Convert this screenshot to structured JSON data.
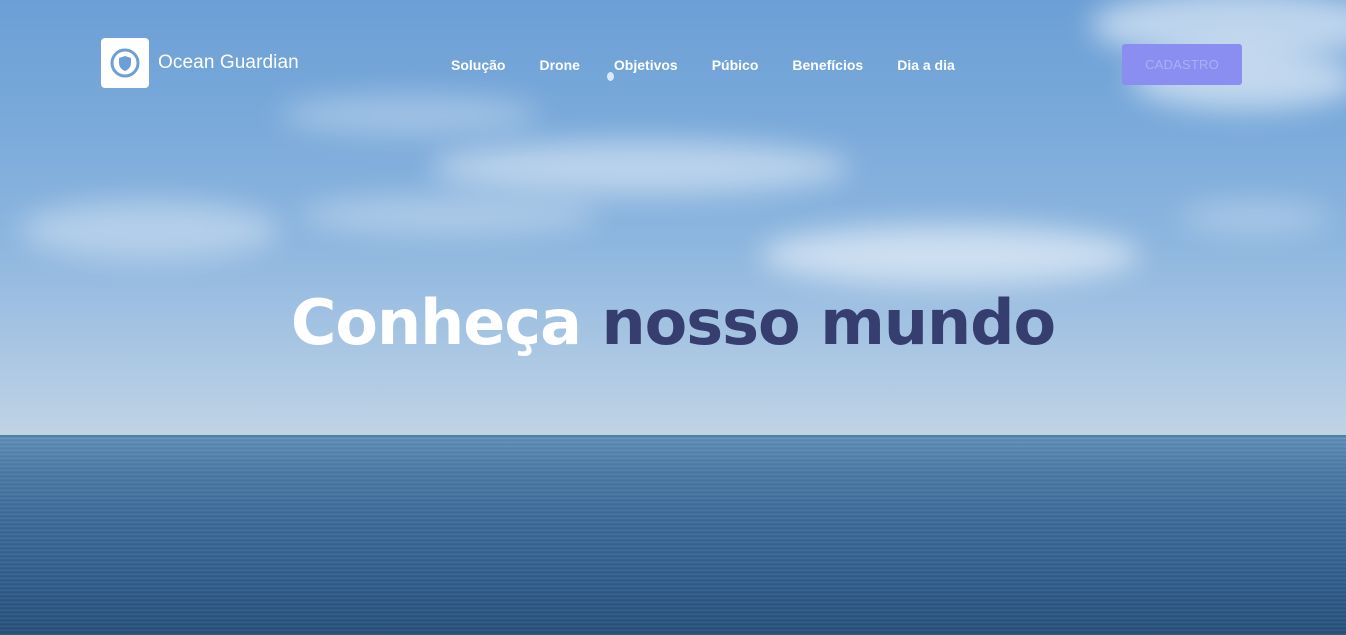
{
  "brand": {
    "name": "Ocean Guardian",
    "logo_icon": "shield-icon"
  },
  "nav": {
    "items": [
      {
        "label": "Solução"
      },
      {
        "label": "Drone"
      },
      {
        "label": "Objetivos"
      },
      {
        "label": "Púbico"
      },
      {
        "label": "Benefícios"
      },
      {
        "label": "Dia a dia"
      }
    ]
  },
  "cta": {
    "label": "CADASTRO",
    "background": "#8a8ef0"
  },
  "hero": {
    "headline_part1": "Conheça",
    "headline_part2": "nosso mundo",
    "accent_color": "#363e70"
  }
}
